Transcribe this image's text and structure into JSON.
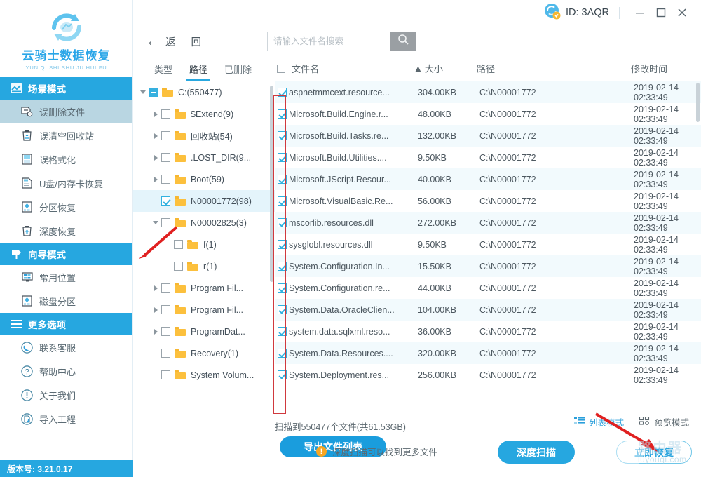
{
  "brand": {
    "title": "云骑士数据恢复",
    "subtitle": "YUN QI SHI SHU JU HUI FU",
    "logo_icon": "recovery-cycle-logo"
  },
  "sidebar": {
    "groups": [
      {
        "label": "场景模式",
        "icon": "scene-mode-icon",
        "items": [
          {
            "label": "误删除文件",
            "icon": "deleted-file-icon",
            "active": true
          },
          {
            "label": "误清空回收站",
            "icon": "recycle-bin-icon",
            "active": false
          },
          {
            "label": "误格式化",
            "icon": "format-disk-icon",
            "active": false
          },
          {
            "label": "U盘/内存卡恢复",
            "icon": "usb-card-icon",
            "active": false
          },
          {
            "label": "分区恢复",
            "icon": "partition-recover-icon",
            "active": false
          },
          {
            "label": "深度恢复",
            "icon": "deep-recover-icon",
            "active": false
          }
        ]
      },
      {
        "label": "向导模式",
        "icon": "wizard-signpost-icon",
        "items": [
          {
            "label": "常用位置",
            "icon": "common-location-icon",
            "active": false
          },
          {
            "label": "磁盘分区",
            "icon": "disk-partition-icon",
            "active": false
          }
        ]
      },
      {
        "label": "更多选项",
        "icon": "hamburger-icon",
        "items": [
          {
            "label": "联系客服",
            "icon": "phone-support-icon",
            "active": false
          },
          {
            "label": "帮助中心",
            "icon": "question-help-icon",
            "active": false
          },
          {
            "label": "关于我们",
            "icon": "info-about-icon",
            "active": false
          },
          {
            "label": "导入工程",
            "icon": "import-project-icon",
            "active": false
          }
        ]
      }
    ],
    "version": "版本号: 3.21.0.17"
  },
  "titlebar": {
    "account_icon": "account-vip-icon",
    "id_text": "ID: 3AQR",
    "minimize_icon": "minimize-icon",
    "maximize_icon": "maximize-icon",
    "close_icon": "close-icon"
  },
  "toolbar": {
    "back_icon": "arrow-left-icon",
    "back_label": "返 回",
    "search_placeholder": "请输入文件名搜索",
    "search_value": "",
    "search_icon": "search-icon"
  },
  "tabs": [
    {
      "label": "类型",
      "active": false
    },
    {
      "label": "路径",
      "active": true
    },
    {
      "label": "已删除",
      "active": false
    }
  ],
  "columns": {
    "name": "文件名",
    "size": "大小",
    "size_sort": "▲",
    "path": "路径",
    "time": "修改时间",
    "select_all_checked": false
  },
  "tree": [
    {
      "label": "C:(550477)",
      "depth": 0,
      "caret": "open",
      "check": "partial",
      "selected": false
    },
    {
      "label": "$Extend(9)",
      "depth": 1,
      "caret": "closed",
      "check": "none",
      "selected": false
    },
    {
      "label": "回收站(54)",
      "depth": 1,
      "caret": "closed",
      "check": "none",
      "selected": false
    },
    {
      "label": ".LOST_DIR(9...",
      "depth": 1,
      "caret": "closed",
      "check": "none",
      "selected": false
    },
    {
      "label": "Boot(59)",
      "depth": 1,
      "caret": "closed",
      "check": "none",
      "selected": false
    },
    {
      "label": "N00001772(98)",
      "depth": 1,
      "caret": "none",
      "check": "checked",
      "selected": true
    },
    {
      "label": "N00002825(3)",
      "depth": 1,
      "caret": "open",
      "check": "none",
      "selected": false
    },
    {
      "label": "f(1)",
      "depth": 2,
      "caret": "none",
      "check": "none",
      "selected": false
    },
    {
      "label": "r(1)",
      "depth": 2,
      "caret": "none",
      "check": "none",
      "selected": false
    },
    {
      "label": "Program Fil...",
      "depth": 1,
      "caret": "closed",
      "check": "none",
      "selected": false
    },
    {
      "label": "Program Fil...",
      "depth": 1,
      "caret": "closed",
      "check": "none",
      "selected": false
    },
    {
      "label": "ProgramDat...",
      "depth": 1,
      "caret": "closed",
      "check": "none",
      "selected": false
    },
    {
      "label": "Recovery(1)",
      "depth": 1,
      "caret": "none",
      "check": "none",
      "selected": false
    },
    {
      "label": "System Volum...",
      "depth": 1,
      "caret": "none",
      "check": "none",
      "selected": false
    }
  ],
  "files": [
    {
      "name": "aspnetmmcext.resource...",
      "size": "304.00KB",
      "path": "C:\\N00001772",
      "time": "2019-02-14 02:33:49",
      "checked": true
    },
    {
      "name": "Microsoft.Build.Engine.r...",
      "size": "48.00KB",
      "path": "C:\\N00001772",
      "time": "2019-02-14 02:33:49",
      "checked": true
    },
    {
      "name": "Microsoft.Build.Tasks.re...",
      "size": "132.00KB",
      "path": "C:\\N00001772",
      "time": "2019-02-14 02:33:49",
      "checked": true
    },
    {
      "name": "Microsoft.Build.Utilities....",
      "size": "9.50KB",
      "path": "C:\\N00001772",
      "time": "2019-02-14 02:33:49",
      "checked": true
    },
    {
      "name": "Microsoft.JScript.Resour...",
      "size": "40.00KB",
      "path": "C:\\N00001772",
      "time": "2019-02-14 02:33:49",
      "checked": true
    },
    {
      "name": "Microsoft.VisualBasic.Re...",
      "size": "56.00KB",
      "path": "C:\\N00001772",
      "time": "2019-02-14 02:33:49",
      "checked": true
    },
    {
      "name": "mscorlib.resources.dll",
      "size": "272.00KB",
      "path": "C:\\N00001772",
      "time": "2019-02-14 02:33:49",
      "checked": true
    },
    {
      "name": "sysglobl.resources.dll",
      "size": "9.50KB",
      "path": "C:\\N00001772",
      "time": "2019-02-14 02:33:49",
      "checked": true
    },
    {
      "name": "System.Configuration.In...",
      "size": "15.50KB",
      "path": "C:\\N00001772",
      "time": "2019-02-14 02:33:49",
      "checked": true
    },
    {
      "name": "System.Configuration.re...",
      "size": "44.00KB",
      "path": "C:\\N00001772",
      "time": "2019-02-14 02:33:49",
      "checked": true
    },
    {
      "name": "System.Data.OracleClien...",
      "size": "104.00KB",
      "path": "C:\\N00001772",
      "time": "2019-02-14 02:33:49",
      "checked": true
    },
    {
      "name": "system.data.sqlxml.reso...",
      "size": "36.00KB",
      "path": "C:\\N00001772",
      "time": "2019-02-14 02:33:49",
      "checked": true
    },
    {
      "name": "System.Data.Resources....",
      "size": "320.00KB",
      "path": "C:\\N00001772",
      "time": "2019-02-14 02:33:49",
      "checked": true
    },
    {
      "name": "System.Deployment.res...",
      "size": "256.00KB",
      "path": "C:\\N00001772",
      "time": "2019-02-14 02:33:49",
      "checked": true
    }
  ],
  "bottom": {
    "scan_summary": "扫描到550477个文件(共61.53GB)",
    "export_label": "导出文件列表",
    "list_mode_label": "列表模式",
    "list_mode_icon": "list-mode-icon",
    "preview_mode_label": "预览模式",
    "preview_mode_icon": "preview-mode-icon",
    "hint_icon": "warning-icon",
    "hint_text": "深度扫描可以找到更多文件",
    "deep_scan_label": "深度扫描",
    "recover_label": "立即恢复"
  },
  "watermark": {
    "text_main": "路由器",
    "text_sub": "luyouqi.com"
  },
  "colors": {
    "brand_blue": "#26a7e0",
    "accent_blue": "#1a9ddd",
    "folder_yellow": "#fcc03d",
    "annotation_red": "#d0393e",
    "active_nav": "#b9d6e2"
  }
}
